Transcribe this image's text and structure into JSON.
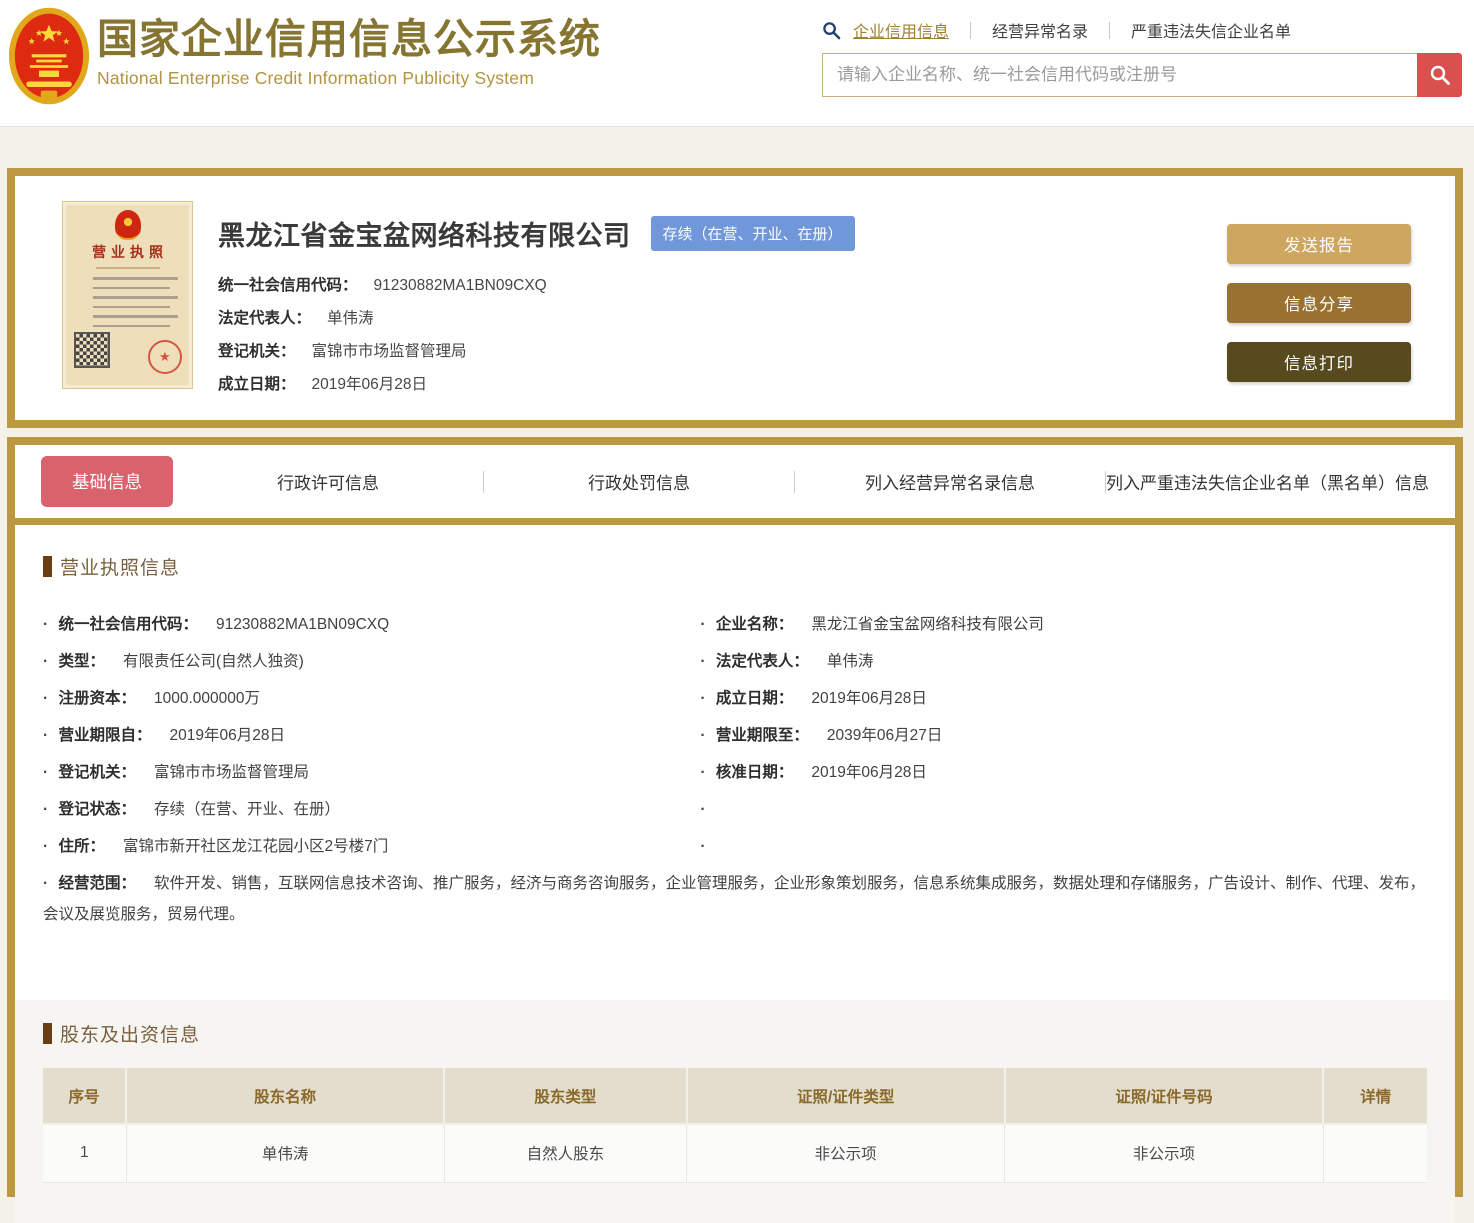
{
  "header": {
    "title_cn": "国家企业信用信息公示系统",
    "title_en": "National Enterprise Credit Information Publicity System",
    "nav": [
      {
        "label": "企业信用信息"
      },
      {
        "label": "经营异常名录"
      },
      {
        "label": "严重违法失信企业名单"
      }
    ],
    "search": {
      "placeholder": "请输入企业名称、统一社会信用代码或注册号"
    }
  },
  "company": {
    "name": "黑龙江省金宝盆网络科技有限公司",
    "status_badge": "存续（在营、开业、在册）",
    "license_thumb_title": "营业执照",
    "summary_fields": [
      {
        "label": "统一社会信用代码：",
        "value": "91230882MA1BN09CXQ"
      },
      {
        "label": "法定代表人：",
        "value": "单伟涛"
      },
      {
        "label": "登记机关：",
        "value": "富锦市市场监督管理局"
      },
      {
        "label": "成立日期：",
        "value": "2019年06月28日"
      }
    ],
    "buttons": [
      {
        "label": "发送报告",
        "color": "#cda65f"
      },
      {
        "label": "信息分享",
        "color": "#997231"
      },
      {
        "label": "信息打印",
        "color": "#564a1e"
      }
    ]
  },
  "tabs": [
    {
      "label": "基础信息",
      "active": true
    },
    {
      "label": "行政许可信息",
      "active": false
    },
    {
      "label": "行政处罚信息",
      "active": false
    },
    {
      "label": "列入经营异常名录信息",
      "active": false
    },
    {
      "label": "列入严重违法失信企业名单（黑名单）信息",
      "active": false
    }
  ],
  "license_section": {
    "title": "营业执照信息",
    "left": [
      {
        "label": "统一社会信用代码：",
        "value": "91230882MA1BN09CXQ"
      },
      {
        "label": "类型：",
        "value": "有限责任公司(自然人独资)"
      },
      {
        "label": "注册资本：",
        "value": "1000.000000万"
      },
      {
        "label": "营业期限自：",
        "value": "2019年06月28日"
      },
      {
        "label": "登记机关：",
        "value": "富锦市市场监督管理局"
      },
      {
        "label": "登记状态：",
        "value": "存续（在营、开业、在册）"
      },
      {
        "label": "住所：",
        "value": "富锦市新开社区龙江花园小区2号楼7门"
      }
    ],
    "right": [
      {
        "label": "企业名称：",
        "value": "黑龙江省金宝盆网络科技有限公司"
      },
      {
        "label": "法定代表人：",
        "value": "单伟涛"
      },
      {
        "label": "成立日期：",
        "value": "2019年06月28日"
      },
      {
        "label": "营业期限至：",
        "value": "2039年06月27日"
      },
      {
        "label": "核准日期：",
        "value": "2019年06月28日"
      }
    ],
    "full": {
      "label": "经营范围：",
      "value": "软件开发、销售，互联网信息技术咨询、推广服务，经济与商务咨询服务，企业管理服务，企业形象策划服务，信息系统集成服务，数据处理和存储服务，广告设计、制作、代理、发布，会议及展览服务，贸易代理。"
    }
  },
  "shareholder": {
    "title": "股东及出资信息",
    "table": {
      "headers": [
        "序号",
        "股东名称",
        "股东类型",
        "证照/证件类型",
        "证照/证件号码",
        "详情"
      ],
      "rows": [
        [
          "1",
          "单伟涛",
          "自然人股东",
          "非公示项",
          "非公示项",
          ""
        ]
      ]
    },
    "colors": {
      "header_bg": "#e3ddcd",
      "header_text": "#8a692a"
    }
  },
  "theme": {
    "gold_border": "#bd9843",
    "active_tab": "#d9636c",
    "badge_blue": "#6f97d9",
    "search_button_red": "#d9514e",
    "title_gold": "#867431"
  }
}
